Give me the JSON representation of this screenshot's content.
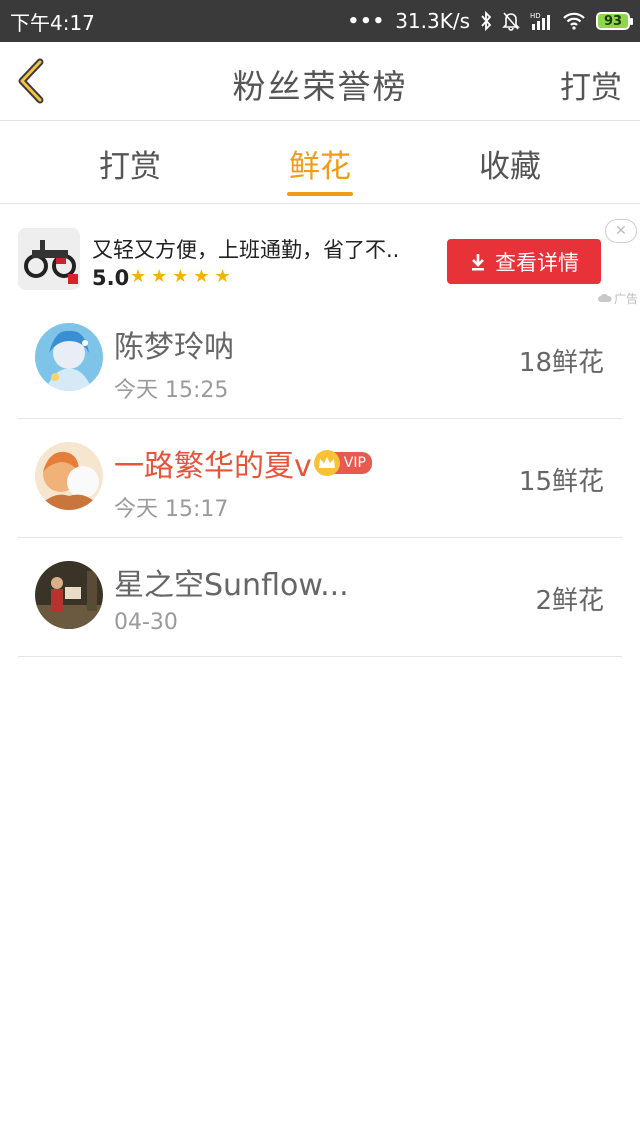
{
  "status_bar": {
    "time": "下午4:17",
    "dots": "•••",
    "speed": "31.3K/s",
    "hd_label": "HD",
    "battery": "93"
  },
  "header": {
    "title": "粉丝荣誉榜",
    "right_action": "打赏"
  },
  "tabs": [
    {
      "label": "打赏",
      "active": false
    },
    {
      "label": "鲜花",
      "active": true
    },
    {
      "label": "收藏",
      "active": false
    }
  ],
  "colors": {
    "accent": "#f29b16",
    "vip_name": "#e6543a",
    "ad_button": "#e8323a",
    "status_bar": "#3a3a3a"
  },
  "ad": {
    "title": "又轻又方便，上班通勤，省了不..",
    "rating": "5.0",
    "stars": "★★★★★",
    "button_label": "查看详情",
    "close": "✕",
    "ad_tag": "广告"
  },
  "list": [
    {
      "name": "陈梦玲呐",
      "time": "今天 15:25",
      "count": "18鲜花",
      "vip": false
    },
    {
      "name": "一路繁华的夏v",
      "time": "今天 15:17",
      "count": "15鲜花",
      "vip": true,
      "vip_label": "VIP"
    },
    {
      "name": "星之空Sunflow...",
      "time": "04-30",
      "count": "2鲜花",
      "vip": false
    }
  ]
}
